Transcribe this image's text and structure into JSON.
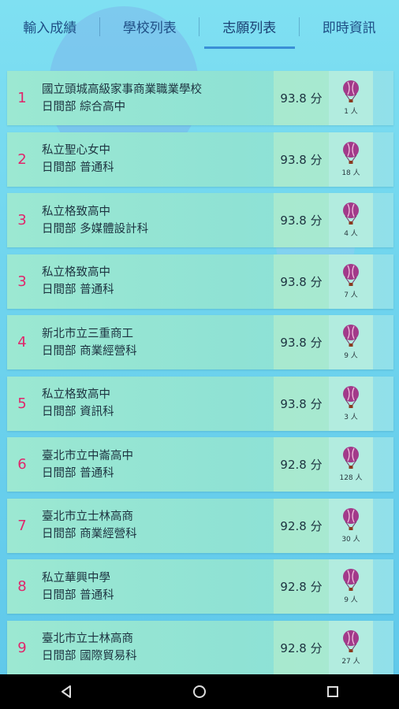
{
  "tabs": [
    {
      "label": "輸入成績"
    },
    {
      "label": "學校列表"
    },
    {
      "label": "志願列表"
    },
    {
      "label": "即時資訊"
    }
  ],
  "active_tab": "志願列表",
  "colors": {
    "rank": "#e0266b",
    "accent": "#3a8fd6",
    "balloon": "#a23a8a"
  },
  "rows": [
    {
      "rank": "1",
      "school": "國立頭城高級家事商業職業學校",
      "dept": "日間部 綜合高中",
      "score": "93.8 分",
      "count": "1 人"
    },
    {
      "rank": "2",
      "school": "私立聖心女中",
      "dept": "日間部 普通科",
      "score": "93.8 分",
      "count": "18 人"
    },
    {
      "rank": "3",
      "school": "私立格致高中",
      "dept": "日間部 多媒體設計科",
      "score": "93.8 分",
      "count": "4 人"
    },
    {
      "rank": "3",
      "school": "私立格致高中",
      "dept": "日間部 普通科",
      "score": "93.8 分",
      "count": "7 人"
    },
    {
      "rank": "4",
      "school": "新北市立三重商工",
      "dept": "日間部 商業經營科",
      "score": "93.8 分",
      "count": "9 人"
    },
    {
      "rank": "5",
      "school": "私立格致高中",
      "dept": "日間部 資訊科",
      "score": "93.8 分",
      "count": "3 人"
    },
    {
      "rank": "6",
      "school": "臺北市立中崙高中",
      "dept": "日間部 普通科",
      "score": "92.8 分",
      "count": "128 人"
    },
    {
      "rank": "7",
      "school": "臺北市立士林高商",
      "dept": "日間部 商業經營科",
      "score": "92.8 分",
      "count": "30 人"
    },
    {
      "rank": "8",
      "school": "私立華興中學",
      "dept": "日間部 普通科",
      "score": "92.8 分",
      "count": "9 人"
    },
    {
      "rank": "9",
      "school": "臺北市立士林高商",
      "dept": "日間部 國際貿易科",
      "score": "92.8 分",
      "count": "27 人"
    }
  ],
  "navbar": {
    "back": "back-icon",
    "home": "home-icon",
    "recents": "recents-icon"
  }
}
